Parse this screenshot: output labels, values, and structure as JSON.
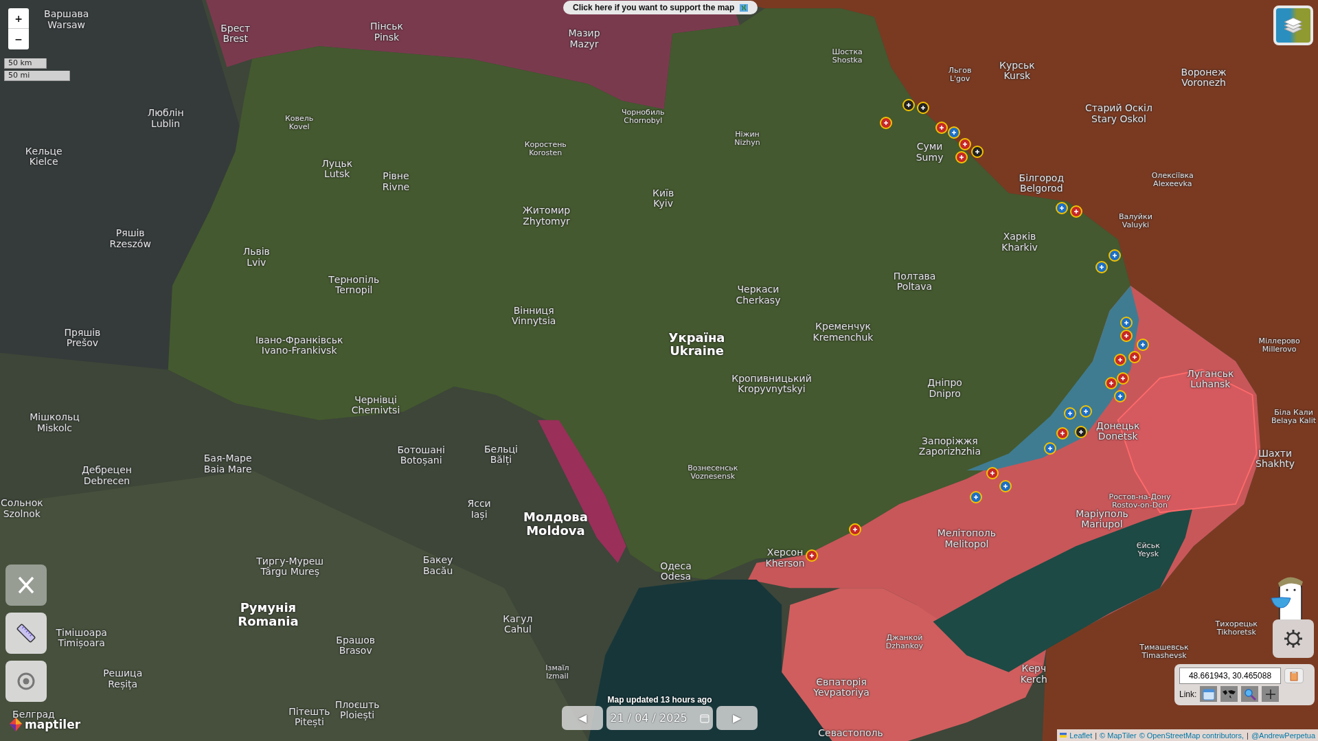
{
  "banner": {
    "text": "Click here if you want to support the map"
  },
  "zoom_controls": {
    "zoom_in": "+",
    "zoom_out": "−"
  },
  "scale": {
    "metric": "50 km",
    "imperial": "50 mi"
  },
  "map_labels": [
    {
      "local": "Варшава",
      "english": "Warsaw",
      "kind": "city"
    },
    {
      "local": "Брест",
      "english": "Brest",
      "kind": "city"
    },
    {
      "local": "Пінськ",
      "english": "Pinsk",
      "kind": "city"
    },
    {
      "local": "Мазир",
      "english": "Mazyr",
      "kind": "city"
    },
    {
      "local": "Шостка",
      "english": "Shostka",
      "kind": "small"
    },
    {
      "local": "Льгов",
      "english": "L'gov",
      "kind": "small"
    },
    {
      "local": "Курськ",
      "english": "Kursk",
      "kind": "city"
    },
    {
      "local": "Воронеж",
      "english": "Voronezh",
      "kind": "city"
    },
    {
      "local": "Люблін",
      "english": "Lublin",
      "kind": "city"
    },
    {
      "local": "Ковель",
      "english": "Kovel",
      "kind": "small"
    },
    {
      "local": "Кельце",
      "english": "Kielce",
      "kind": "city"
    },
    {
      "local": "Чорнобиль",
      "english": "Chornobyl",
      "kind": "small"
    },
    {
      "local": "Коростень",
      "english": "Korosten",
      "kind": "small"
    },
    {
      "local": "Ніжин",
      "english": "Nizhyn",
      "kind": "small"
    },
    {
      "local": "Суми",
      "english": "Sumy",
      "kind": "city"
    },
    {
      "local": "Старий Оскіл",
      "english": "Stary Oskol",
      "kind": "city"
    },
    {
      "local": "Луцьк",
      "english": "Lutsk",
      "kind": "city"
    },
    {
      "local": "Рівне",
      "english": "Rivne",
      "kind": "city"
    },
    {
      "local": "Київ",
      "english": "Kyiv",
      "kind": "city"
    },
    {
      "local": "Житомир",
      "english": "Zhytomyr",
      "kind": "city"
    },
    {
      "local": "Білгород",
      "english": "Belgorod",
      "kind": "city"
    },
    {
      "local": "Олексіївка",
      "english": "Alexeevka",
      "kind": "small"
    },
    {
      "local": "Ряшів",
      "english": "Rzeszów",
      "kind": "city"
    },
    {
      "local": "Львів",
      "english": "Lviv",
      "kind": "city"
    },
    {
      "local": "Харків",
      "english": "Kharkiv",
      "kind": "city"
    },
    {
      "local": "Валуйки",
      "english": "Valuyki",
      "kind": "small"
    },
    {
      "local": "Тернопіль",
      "english": "Ternopil",
      "kind": "city"
    },
    {
      "local": "Полтава",
      "english": "Poltava",
      "kind": "city"
    },
    {
      "local": "Черкаси",
      "english": "Cherkasy",
      "kind": "city"
    },
    {
      "local": "Вінниця",
      "english": "Vinnytsia",
      "kind": "city"
    },
    {
      "local": "Пряшів",
      "english": "Prešov",
      "kind": "city"
    },
    {
      "local": "Україна",
      "english": "Ukraine",
      "kind": "country"
    },
    {
      "local": "Кременчук",
      "english": "Kremenchuk",
      "kind": "city"
    },
    {
      "local": "Івано-Франківськ",
      "english": "Ivano-Frankivsk",
      "kind": "city"
    },
    {
      "local": "Міллерово",
      "english": "Millerovo",
      "kind": "small"
    },
    {
      "local": "Кропивницький",
      "english": "Kropyvnytskyi",
      "kind": "city"
    },
    {
      "local": "Дніпро",
      "english": "Dnipro",
      "kind": "city"
    },
    {
      "local": "Луганськ",
      "english": "Luhansk",
      "kind": "city"
    },
    {
      "local": "Чернівці",
      "english": "Chernivtsi",
      "kind": "city"
    },
    {
      "local": "Мішкольц",
      "english": "Miskolc",
      "kind": "city"
    },
    {
      "local": "Донецьк",
      "english": "Donetsk",
      "kind": "city"
    },
    {
      "local": "Біла Кали",
      "english": "Belaya Kalit",
      "kind": "small"
    },
    {
      "local": "Шахти",
      "english": "Shakhty",
      "kind": "city"
    },
    {
      "local": "Запоріжжя",
      "english": "Zaporizhzhia",
      "kind": "city"
    },
    {
      "local": "Ботошані",
      "english": "Botoșani",
      "kind": "city"
    },
    {
      "local": "Бельці",
      "english": "Bălți",
      "kind": "city"
    },
    {
      "local": "Бая-Маре",
      "english": "Baia Mare",
      "kind": "city"
    },
    {
      "local": "Дебрецен",
      "english": "Debrecen",
      "kind": "city"
    },
    {
      "local": "Вознесенськ",
      "english": "Voznesensk",
      "kind": "small"
    },
    {
      "local": "Ясси",
      "english": "Iași",
      "kind": "city"
    },
    {
      "local": "Молдова",
      "english": "Moldova",
      "kind": "country"
    },
    {
      "local": "Сольнок",
      "english": "Szolnok",
      "kind": "city"
    },
    {
      "local": "Ростов-на-Дону",
      "english": "Rostov-on-Don",
      "kind": "small"
    },
    {
      "local": "Маріуполь",
      "english": "Mariupol",
      "kind": "city"
    },
    {
      "local": "Мелітополь",
      "english": "Melitopol",
      "kind": "city"
    },
    {
      "local": "Єйськ",
      "english": "Yeysk",
      "kind": "small"
    },
    {
      "local": "Тиргу-Муреш",
      "english": "Târgu Mureș",
      "kind": "city"
    },
    {
      "local": "Бакеу",
      "english": "Bacău",
      "kind": "city"
    },
    {
      "local": "Одеса",
      "english": "Odesa",
      "kind": "city"
    },
    {
      "local": "Херсон",
      "english": "Kherson",
      "kind": "city"
    },
    {
      "local": "Румунія",
      "english": "Romania",
      "kind": "country"
    },
    {
      "local": "Тімішоара",
      "english": "Timișoara",
      "kind": "city"
    },
    {
      "local": "Брашов",
      "english": "Brasov",
      "kind": "city"
    },
    {
      "local": "Кагул",
      "english": "Cahul",
      "kind": "city"
    },
    {
      "local": "Тихорецьк",
      "english": "Tikhoretsk",
      "kind": "small"
    },
    {
      "local": "Тимашевськ",
      "english": "Timashevsk",
      "kind": "small"
    },
    {
      "local": "Джанкой",
      "english": "Dzhankoy",
      "kind": "small"
    },
    {
      "local": "Ізмаїл",
      "english": "Izmail",
      "kind": "small"
    },
    {
      "local": "Керч",
      "english": "Kerch",
      "kind": "city"
    },
    {
      "local": "Решица",
      "english": "Reșița",
      "kind": "city"
    },
    {
      "local": "Євпаторія",
      "english": "Yevpatoriya",
      "kind": "city"
    },
    {
      "local": "Плоєшть",
      "english": "Ploiești",
      "kind": "city"
    },
    {
      "local": "Пітешть",
      "english": "Pitești",
      "kind": "city"
    },
    {
      "local": "Севастополь",
      "kind": "city"
    },
    {
      "local": "Белград",
      "kind": "city"
    }
  ],
  "logo": {
    "text": "maptiler"
  },
  "update_notice": "Map updated 13 hours ago",
  "date_picker": {
    "prev": "◀",
    "date": "21 / 04 / 2025",
    "next": "▶"
  },
  "coordinates": {
    "value": "48.661943, 30.465088",
    "link_label": "Link:"
  },
  "attribution": [
    {
      "text": "Leaflet",
      "link": true
    },
    {
      "text": "|",
      "link": false
    },
    {
      "text": "© MapTiler",
      "link": true
    },
    {
      "text": "© OpenStreetMap contributors,",
      "link": true
    },
    {
      "text": "|",
      "link": false
    },
    {
      "text": "@AndrewPerpetua",
      "link": true
    }
  ]
}
